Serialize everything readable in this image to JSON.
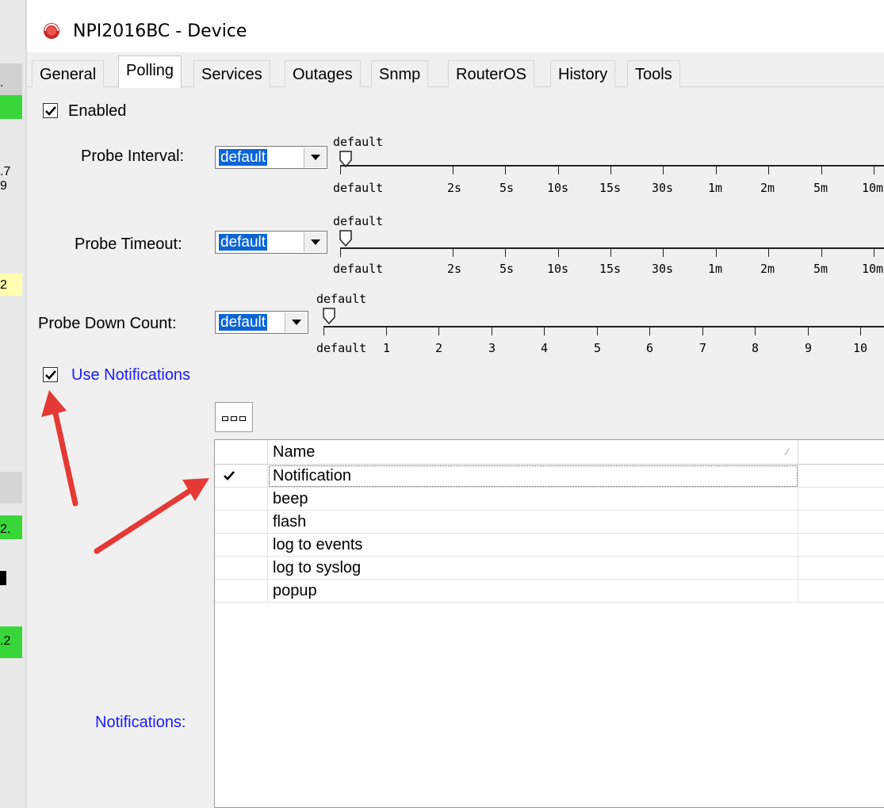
{
  "window": {
    "title": "NPI2016BC - Device",
    "icon": "app-logo-icon"
  },
  "tabs": [
    {
      "label": "General"
    },
    {
      "label": "Polling",
      "active": true
    },
    {
      "label": "Services"
    },
    {
      "label": "Outages"
    },
    {
      "label": "Snmp"
    },
    {
      "label": "RouterOS"
    },
    {
      "label": "History"
    },
    {
      "label": "Tools"
    }
  ],
  "enabled": {
    "label": "Enabled",
    "checked": true
  },
  "probe_interval": {
    "label": "Probe Interval:",
    "value": "default",
    "slider_value": "default",
    "ticks": [
      "default",
      "2s",
      "5s",
      "10s",
      "15s",
      "30s",
      "1m",
      "2m",
      "5m",
      "10m"
    ]
  },
  "probe_timeout": {
    "label": "Probe Timeout:",
    "value": "default",
    "slider_value": "default",
    "ticks": [
      "default",
      "2s",
      "5s",
      "10s",
      "15s",
      "30s",
      "1m",
      "2m",
      "5m",
      "10m"
    ]
  },
  "probe_down_count": {
    "label": "Probe Down Count:",
    "value": "default",
    "slider_value": "default",
    "ticks": [
      "default",
      "1",
      "2",
      "3",
      "4",
      "5",
      "6",
      "7",
      "8",
      "9",
      "10"
    ]
  },
  "use_notifications": {
    "label": "Use Notifications",
    "checked": true
  },
  "notifications": {
    "label": "Notifications:",
    "more_button_icon": "ellipsis-icon",
    "column_name": "Name",
    "rows": [
      {
        "checked": true,
        "name": "Notification"
      },
      {
        "checked": false,
        "name": "beep"
      },
      {
        "checked": false,
        "name": "flash"
      },
      {
        "checked": false,
        "name": "log to events"
      },
      {
        "checked": false,
        "name": "log to syslog"
      },
      {
        "checked": false,
        "name": "popup"
      }
    ]
  },
  "background_fragments": [
    ".",
    ".7",
    "9",
    "2",
    "2.",
    ".2"
  ],
  "colors": {
    "link_blue": "#1a1aff",
    "selection": "#0a64d6",
    "annotation_arrow": "#e53935"
  }
}
